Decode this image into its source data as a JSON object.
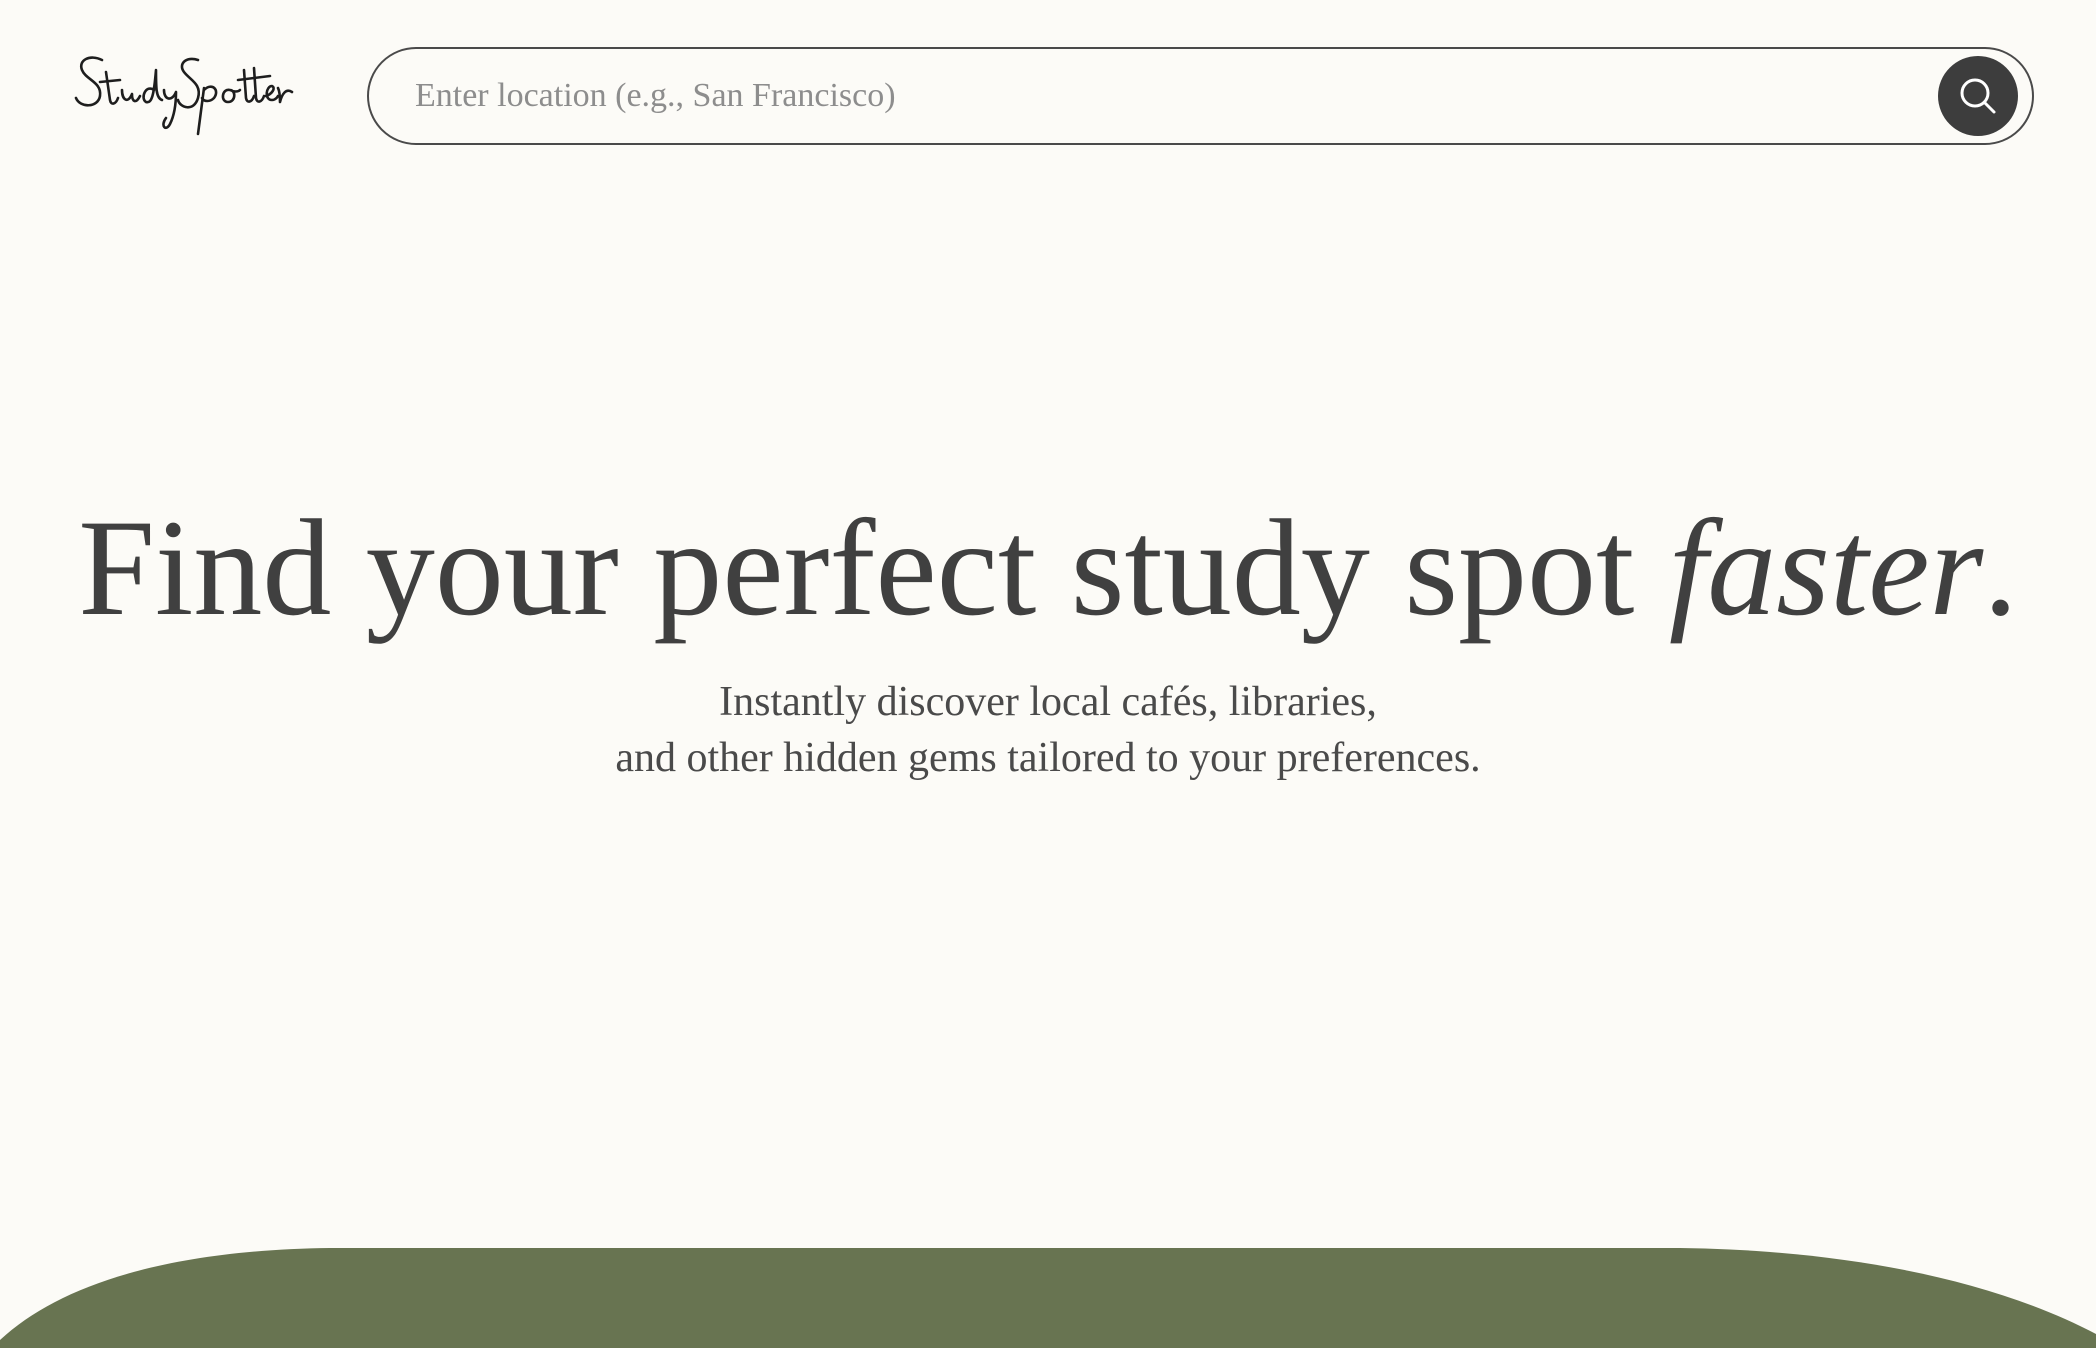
{
  "header": {
    "logo_text": "StudySpotter",
    "search": {
      "placeholder": "Enter location (e.g., San Francisco)",
      "value": "",
      "button_icon": "search-icon"
    }
  },
  "hero": {
    "title_main": "Find your perfect study spot ",
    "title_accent": "faster",
    "title_end": ".",
    "subtitle_line1": "Instantly discover local cafés, libraries,",
    "subtitle_line2": "and other hidden gems tailored to your preferences."
  },
  "colors": {
    "background": "#fcfbf7",
    "text": "#404040",
    "search_button": "#3d3d3d",
    "accent_green": "#687451"
  }
}
